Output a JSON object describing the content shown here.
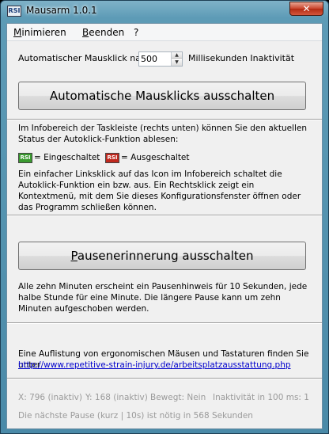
{
  "window": {
    "icon_text": "RSI",
    "title": "Mausarm 1.0.1",
    "close_symbol": "✕"
  },
  "menu": {
    "items": [
      {
        "prefix": "",
        "underline": "M",
        "rest": "inimieren"
      },
      {
        "prefix": "",
        "underline": "B",
        "rest": "eenden"
      },
      {
        "prefix": "",
        "underline": "",
        "rest": "?"
      }
    ]
  },
  "autoclick": {
    "label_before": "Automatischer Mausklick nach",
    "value": "500",
    "label_after": "Millisekunden Inaktivität",
    "toggle_button": "Automatische Mausklicks ausschalten"
  },
  "info": {
    "paragraph1": "Im Infobereich der Taskleiste (rechts unten) können Sie den aktuellen Status der Autoklick-Funktion ablesen:",
    "legend_on_icon": "RSI",
    "legend_on": "= Eingeschaltet",
    "legend_off_icon": "RSI",
    "legend_off": "= Ausgeschaltet",
    "paragraph2": "Ein einfacher Linksklick auf das Icon im Infobereich schaltet die Autoklick-Funktion ein bzw. aus. Ein Rechtsklick zeigt ein Kontextmenü, mit dem Sie dieses Konfigurationsfenster öffnen oder das Programm schließen können."
  },
  "pause": {
    "button_underline": "P",
    "button_rest": "ausenerinnerung ausschalten",
    "paragraph": "Alle zehn Minuten erscheint ein Pausenhinweis für 10 Sekunden, jede halbe Stunde für eine Minute. Die längere Pause kann um zehn Minuten aufgeschoben werden."
  },
  "footer": {
    "text": "Eine Auflistung von ergonomischen Mäusen und Tastaturen finden Sie unter",
    "link": "http://www.repetitive-strain-injury.de/arbeitsplatzausstattung.php"
  },
  "status": {
    "x": "X: 796 (inaktiv)",
    "y": "Y: 168 (inaktiv)",
    "moved": "Bewegt: Nein",
    "inactivity": "Inaktivität in 100 ms: 1",
    "next_pause": "Die nächste Pause (kurz | 10s) ist nötig in 568 Sekunden"
  }
}
